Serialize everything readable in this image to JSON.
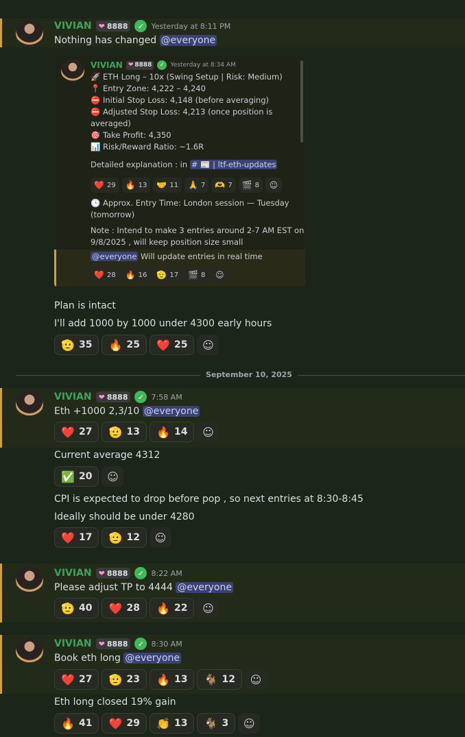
{
  "colors": {
    "background": "#1c2519",
    "username": "#3ba55c",
    "mention_bg": "#3c4270",
    "highlight_bar": "#d1a13a"
  },
  "user": {
    "name": "VIVIAN",
    "badge": "8888",
    "badge_icon": "pink-heart-icon",
    "verified_icon": "check-icon"
  },
  "msg1": {
    "timestamp": "Yesterday at 8:11 PM",
    "text": "Nothing has changed",
    "mention": "@everyone",
    "embed": {
      "timestamp": "Yesterday at 8:34 AM",
      "lines": [
        "🚀 ETH Long – 10x (Swing Setup | Risk: Medium)",
        "📍 Entry Zone: 4,222 – 4,240",
        "⛔ Initial Stop Loss: 4,148 (before averaging)",
        "⛔ Adjusted Stop Loss: 4,213 (once position is",
        "averaged)",
        "🎯 Take Profit: 4,350",
        "📊 Risk/Reward Ratio: ~1.6R"
      ],
      "detail_prefix": "Detailed explanation : in",
      "detail_channel": "# 📰 | ltf-eth-updates",
      "reactions1": [
        {
          "emoji": "❤️",
          "count": "29"
        },
        {
          "emoji": "🔥",
          "count": "13"
        },
        {
          "emoji": "🤝",
          "count": "11"
        },
        {
          "emoji": "🙏",
          "count": "7"
        },
        {
          "emoji": "🫶",
          "count": "7"
        },
        {
          "emoji": "🎬",
          "count": "8"
        }
      ],
      "time_line1": "🕒 Approx. Entry Time: London session — Tuesday",
      "time_line2": "(tomorrow)",
      "note_line1": "Note : Intend to make 3 entries around 2-7 AM EST on",
      "note_line2": "9/8/2025 , will keep position size small",
      "quote_mention": "@everyone",
      "quote_text": "Will update entries in real time",
      "reactions2": [
        {
          "emoji": "❤️",
          "count": "28"
        },
        {
          "emoji": "🔥",
          "count": "16"
        },
        {
          "emoji": "🫡",
          "count": "17"
        },
        {
          "emoji": "🎬",
          "count": "8"
        }
      ]
    },
    "follow1": "Plan is intact",
    "follow2": "I'll add 1000 by 1000 under 4300 early hours",
    "reactions": [
      {
        "emoji": "🫡",
        "count": "35"
      },
      {
        "emoji": "🔥",
        "count": "25"
      },
      {
        "emoji": "❤️",
        "count": "25"
      }
    ]
  },
  "date_divider": "September 10, 2025",
  "msg2": {
    "timestamp": "7:58 AM",
    "text": "Eth +1000 2,3/10",
    "mention": "@everyone",
    "reactions": [
      {
        "emoji": "❤️",
        "count": "27"
      },
      {
        "emoji": "🫡",
        "count": "13"
      },
      {
        "emoji": "🔥",
        "count": "14"
      }
    ],
    "follow1": "Current average 4312",
    "follow1_reactions": [
      {
        "emoji": "✅",
        "count": "20"
      }
    ],
    "follow2": "CPI is expected to drop before pop , so next entries at 8:30-8:45",
    "follow3": "Ideally should be under 4280",
    "follow3_reactions": [
      {
        "emoji": "❤️",
        "count": "17"
      },
      {
        "emoji": "🫡",
        "count": "12"
      }
    ]
  },
  "msg3": {
    "timestamp": "8:22 AM",
    "text": "Please adjust TP to 4444",
    "mention": "@everyone",
    "reactions": [
      {
        "emoji": "🫡",
        "count": "40"
      },
      {
        "emoji": "❤️",
        "count": "28"
      },
      {
        "emoji": "🔥",
        "count": "22"
      }
    ]
  },
  "msg4": {
    "timestamp": "8:30 AM",
    "text": "Book eth long",
    "mention": "@everyone",
    "reactions": [
      {
        "emoji": "❤️",
        "count": "27"
      },
      {
        "emoji": "🫡",
        "count": "23"
      },
      {
        "emoji": "🔥",
        "count": "13"
      },
      {
        "emoji": "🐐",
        "count": "12"
      }
    ],
    "follow1": "Eth long closed 19% gain",
    "follow1_reactions": [
      {
        "emoji": "🔥",
        "count": "41"
      },
      {
        "emoji": "❤️",
        "count": "29"
      },
      {
        "emoji": "👏",
        "count": "13"
      },
      {
        "emoji": "🐐",
        "count": "3"
      }
    ]
  },
  "add_reaction_icon": "smiley-add-icon"
}
